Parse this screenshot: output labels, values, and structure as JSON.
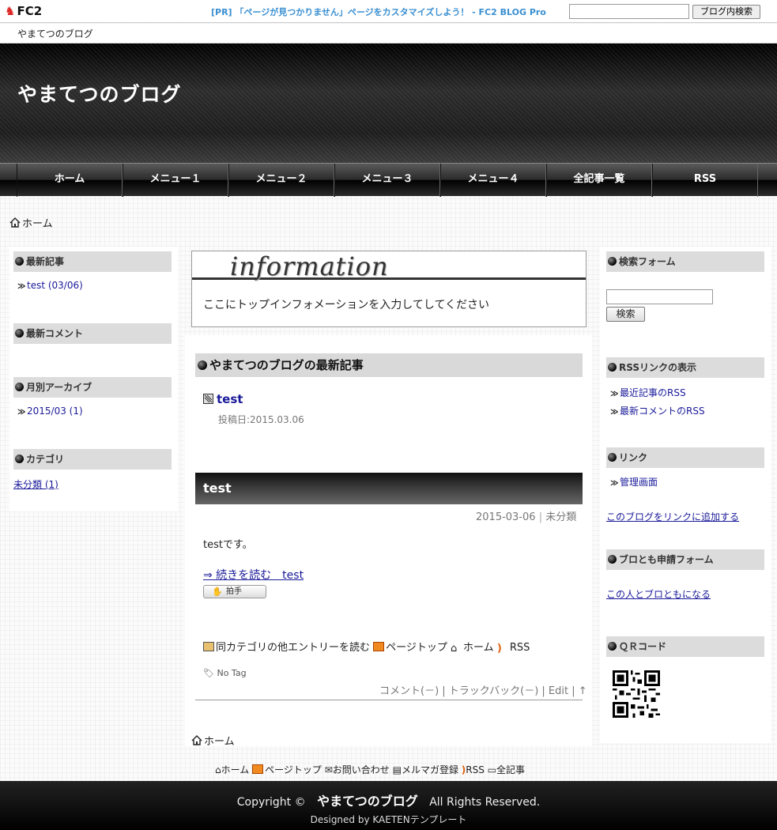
{
  "fc2bar": {
    "logo": "FC2",
    "pr_text": "[PR] 「ページが見つかりません」ページをカスタマイズしよう！ - FC2 BLOG Pro",
    "search_button": "ブログ内検索",
    "blog_name": "やまてつのブログ"
  },
  "header": {
    "title": "やまてつのブログ"
  },
  "nav": {
    "items": [
      "ホーム",
      "メニュー１",
      "メニュー２",
      "メニュー３",
      "メニュー４",
      "全記事一覧",
      "RSS"
    ]
  },
  "breadcrumb": {
    "top": "ホーム",
    "bottom": "ホーム"
  },
  "left_sidebar": {
    "recent_title": "最新記事",
    "recent_item": "test (03/06)",
    "comments_title": "最新コメント",
    "archive_title": "月別アーカイブ",
    "archive_item": "2015/03 (1)",
    "category_title": "カテゴリ",
    "category_item": "未分類 (1)"
  },
  "right_sidebar": {
    "search_title": "検索フォーム",
    "search_button": "検索",
    "rss_title": "RSSリンクの表示",
    "rss_items": [
      "最近記事のRSS",
      "最新コメントのRSS"
    ],
    "links_title": "リンク",
    "links_item": "管理画面",
    "add_link": "このブログをリンクに追加する",
    "friend_title": "ブロとも申請フォーム",
    "friend_link": "この人とブロともになる",
    "qr_title": "ＱＲコード"
  },
  "info": {
    "title": "information",
    "text": "ここにトップインフォメーションを入力してしてください"
  },
  "latest": {
    "heading": "やまてつのブログの最新記事",
    "entry_title": "test",
    "posted": "投稿日:2015.03.06"
  },
  "entry": {
    "title": "test",
    "meta_date": "2015-03-06",
    "meta_sep": "|",
    "meta_category": "未分類",
    "body": "testです。",
    "read_more": "⇒ 続きを読む　test",
    "clap": "拍手",
    "tools": {
      "same_category": "同カテゴリの他エントリーを読む",
      "page_top": "ページトップ",
      "home": "ホーム",
      "rss": "RSS"
    },
    "no_tag": "No Tag",
    "bottom_meta": "コメント(－) | トラックバック(－) | Edit | ↑"
  },
  "footer_links": [
    "ホーム",
    "ページトップ",
    "お問い合わせ",
    "メルマガ登録",
    "RSS",
    "全記事"
  ],
  "footer": {
    "copyright_prefix": "Copyright ©",
    "copyright_name": "やまてつのブログ",
    "copyright_suffix": "All Rights Reserved.",
    "designed": "Designed by KAETENテンプレート"
  }
}
